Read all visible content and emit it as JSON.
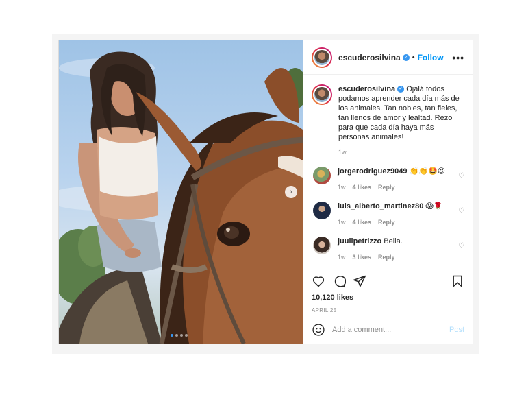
{
  "header": {
    "username": "escuderosilvina",
    "separator": "•",
    "follow_label": "Follow",
    "more_label": "•••"
  },
  "caption": {
    "username": "escuderosilvina",
    "text": "Ojalá todos podamos aprender cada día más de los animales. Tan nobles, tan fieles, tan llenos de amor y lealtad. Rezo para que cada día haya más personas animales!",
    "time": "1w"
  },
  "comments": [
    {
      "username": "jorgerodriguez9049",
      "text": "👏👏🤩😍",
      "time": "1w",
      "likes": "4 likes",
      "reply": "Reply"
    },
    {
      "username": "luis_alberto_martinez80",
      "text": "😱🌹",
      "time": "1w",
      "likes": "4 likes",
      "reply": "Reply"
    },
    {
      "username": "juulipetrizzo",
      "text": "Bella.",
      "time": "1w",
      "likes": "3 likes",
      "reply": "Reply"
    }
  ],
  "post": {
    "likes": "10,120 likes",
    "date": "APRIL 25"
  },
  "add_comment": {
    "placeholder": "Add a comment...",
    "post_label": "Post"
  },
  "carousel": {
    "next_icon": "›",
    "slides": 4,
    "active": 1
  },
  "colors": {
    "accent": "#0095f6",
    "verified": "#3897f0",
    "muted": "#8e8e8e"
  }
}
